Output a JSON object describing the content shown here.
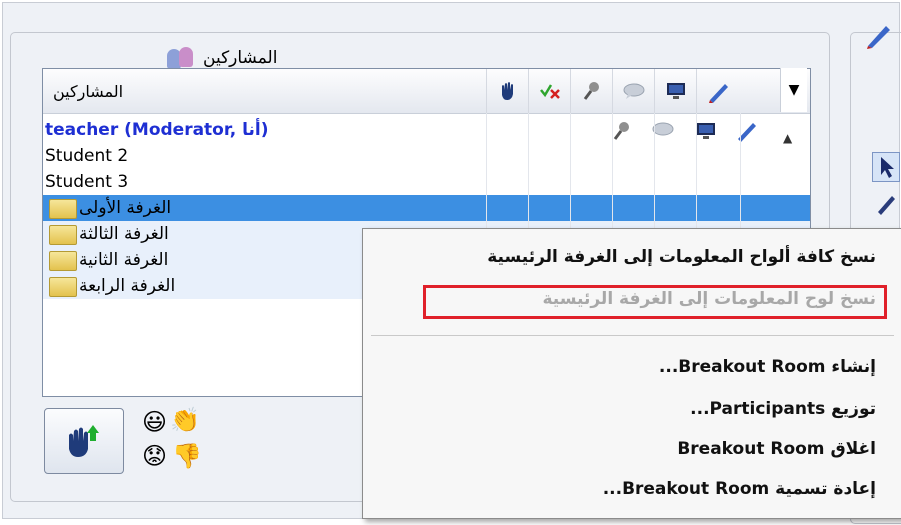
{
  "panel": {
    "title": "المشاركين"
  },
  "list": {
    "header_label": "المشاركين",
    "rows": [
      {
        "label": "teacher (Moderator, أنا)"
      },
      {
        "label": "Student 2"
      },
      {
        "label": "Student 3"
      }
    ],
    "rooms": [
      {
        "label": "الغرفة الأولى"
      },
      {
        "label": "الغرفة الثالثة"
      },
      {
        "label": "الغرفة الثانية"
      },
      {
        "label": "الغرفة الرابعة"
      }
    ]
  },
  "context_menu": {
    "items": [
      {
        "label": "نسخ كافة ألواح المعلومات إلى الغرفة الرئيسية",
        "enabled": true
      },
      {
        "label": "نسخ لوح المعلومات إلى الغرفة الرئيسية",
        "enabled": false
      },
      {
        "label": "إنشاء Breakout Room...",
        "enabled": true
      },
      {
        "label": "توزيع Participants...",
        "enabled": true
      },
      {
        "label": "اغلاق Breakout Room",
        "enabled": true
      },
      {
        "label": "إعادة تسمية Breakout Room...",
        "enabled": true
      }
    ]
  },
  "icons": {
    "header": [
      "pencil-icon",
      "monitor-icon",
      "chat-bubble-icon",
      "microphone-icon",
      "check-x-icon",
      "hand-icon"
    ],
    "bottom": [
      "raise-hand-button-icon",
      "applause-icon",
      "smiley-icon",
      "thumbs-down-icon",
      "sad-face-icon"
    ]
  },
  "colors": {
    "selection": "#3c8fe2",
    "moderator_text": "#1e2fd3",
    "highlight_box": "#e0202a"
  }
}
